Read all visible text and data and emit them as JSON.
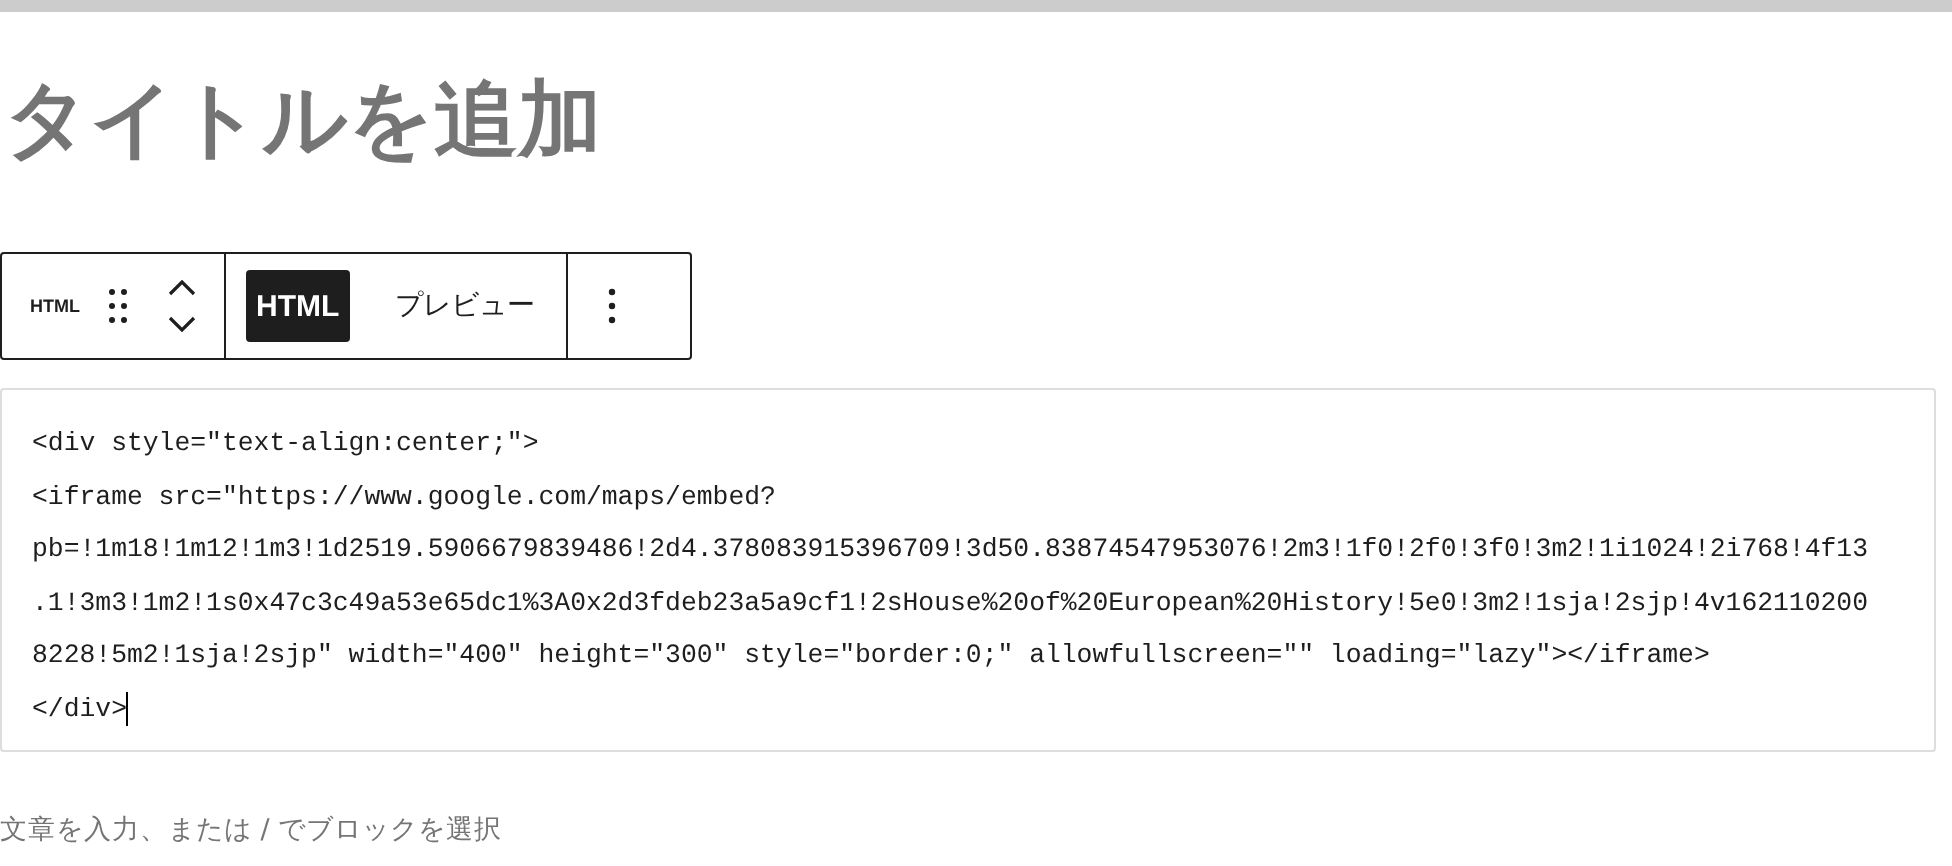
{
  "title": "タイトルを追加",
  "toolbar": {
    "block_label": "HTML",
    "tabs": [
      {
        "label": "HTML",
        "selected": true
      },
      {
        "label": "プレビュー",
        "selected": false
      }
    ]
  },
  "code_lines": [
    "<div style=\"text-align:center;\">",
    "<iframe src=\"https://www.google.com/maps/embed?",
    "pb=!1m18!1m12!1m3!1d2519.5906679839486!2d4.378083915396709!3d50.83874547953076!2m3!1f0!2f0!3f0!3m2!1i1024!2i768!4f13",
    ".1!3m3!1m2!1s0x47c3c49a53e65dc1%3A0x2d3fdeb23a5a9cf1!2sHouse%20of%20European%20History!5e0!3m2!1sja!2sjp!4v162110200",
    "8228!5m2!1sja!2sjp\" width=\"400\" height=\"300\" style=\"border:0;\" allowfullscreen=\"\" loading=\"lazy\"></iframe>",
    "</div>"
  ],
  "placeholder": "文章を入力、または / でブロックを選択"
}
